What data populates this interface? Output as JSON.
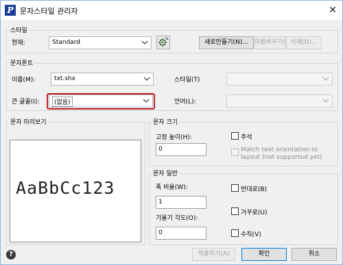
{
  "window": {
    "title": "문자스타일 관리자",
    "close_glyph": "✕",
    "app_icon_letter": "P"
  },
  "style_group": {
    "title": "스타일",
    "current_label": "현재:",
    "current_value": "Standard",
    "new_button": "새로만들기(N)...",
    "rename_button": "이름바꾸기(R)",
    "delete_button": "삭제(D)..."
  },
  "font_group": {
    "title": "문자폰트",
    "name_label": "이름(M):",
    "name_value": "txt.shx",
    "style_label": "스타일(T)",
    "big_font_label": "큰 글꼴(I):",
    "big_font_value": "(없음)",
    "language_label": "언어(L):"
  },
  "preview_group": {
    "title": "문자 미리보기",
    "sample_text": "AaBbCc123"
  },
  "size_group": {
    "title": "문자 크기",
    "fixed_height_label": "고정 높이(H):",
    "fixed_height_value": "0",
    "annotative_label": "주석",
    "match_orientation_label_line1": "Match text orientation to",
    "match_orientation_label_line2": "layout (not supported yet)"
  },
  "general_group": {
    "title": "문자 일반",
    "width_factor_label": "폭 비율(W):",
    "width_factor_value": "1",
    "oblique_angle_label": "기울기 각도(O):",
    "oblique_angle_value": "0",
    "upside_down_label": "반대로(B)",
    "backwards_label": "거꾸로(U)",
    "vertical_label": "수직(V)"
  },
  "footer": {
    "apply_button": "적용하기(A)",
    "ok_button": "확인",
    "cancel_button": "취소",
    "help_glyph": "?"
  }
}
